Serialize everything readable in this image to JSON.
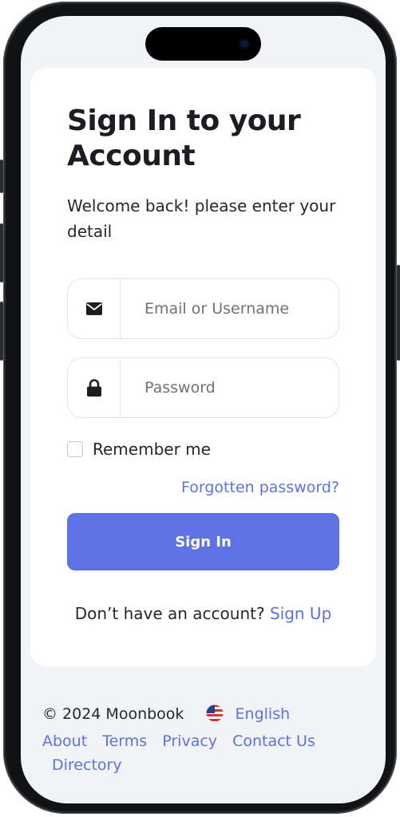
{
  "login": {
    "title": "Sign In to your Account",
    "subtitle": "Welcome back! please enter your detail",
    "email_placeholder": "Email or Username",
    "password_placeholder": "Password",
    "remember_label": "Remember me",
    "forgot_link": "Forgotten password?",
    "signin_button": "Sign In",
    "no_account_text": "Don’t have an account?",
    "signup_link": "Sign Up"
  },
  "footer": {
    "copyright": "© 2024 Moonbook",
    "language": "English",
    "links": [
      "About",
      "Terms",
      "Privacy",
      "Contact Us",
      "Directory"
    ]
  },
  "icons": {
    "email": "envelope-icon",
    "password": "lock-icon",
    "language": "us-flag-icon"
  },
  "colors": {
    "accent": "#5d72e3",
    "link": "#5d72dd",
    "background": "#f2f3f7",
    "card": "#ffffff"
  }
}
